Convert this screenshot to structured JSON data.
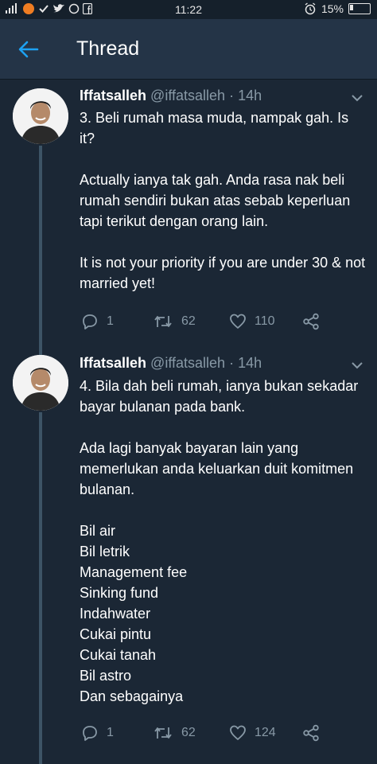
{
  "status_bar": {
    "carrier_icons": "📶",
    "time": "11:22",
    "battery": "15%"
  },
  "header": {
    "title": "Thread",
    "back_icon": "arrow-left-icon"
  },
  "tweets": [
    {
      "name": "Iffatsalleh",
      "handle": "@iffatsalleh",
      "time": "14h",
      "text": "3. Beli rumah masa muda, nampak gah. Is it?\n\nActually ianya tak gah. Anda rasa nak beli rumah sendiri bukan atas sebab keperluan tapi terikut dengan orang lain.\n\nIt is not your priority if you are under 30 & not married yet!",
      "replies": "1",
      "retweets": "62",
      "likes": "110"
    },
    {
      "name": "Iffatsalleh",
      "handle": "@iffatsalleh",
      "time": "14h",
      "text": "4. Bila dah beli rumah, ianya bukan sekadar bayar bulanan pada bank.\n\nAda lagi banyak bayaran lain yang memerlukan anda keluarkan duit komitmen bulanan.\n\nBil air\nBil letrik\nManagement fee\nSinking fund\nIndahwater\nCukai pintu\nCukai tanah\nBil astro\nDan sebagainya",
      "replies": "1",
      "retweets": "62",
      "likes": "124"
    }
  ],
  "colors": {
    "background": "#1b2735",
    "header": "#243447",
    "accent": "#1da1f2",
    "muted": "#8899a6"
  }
}
